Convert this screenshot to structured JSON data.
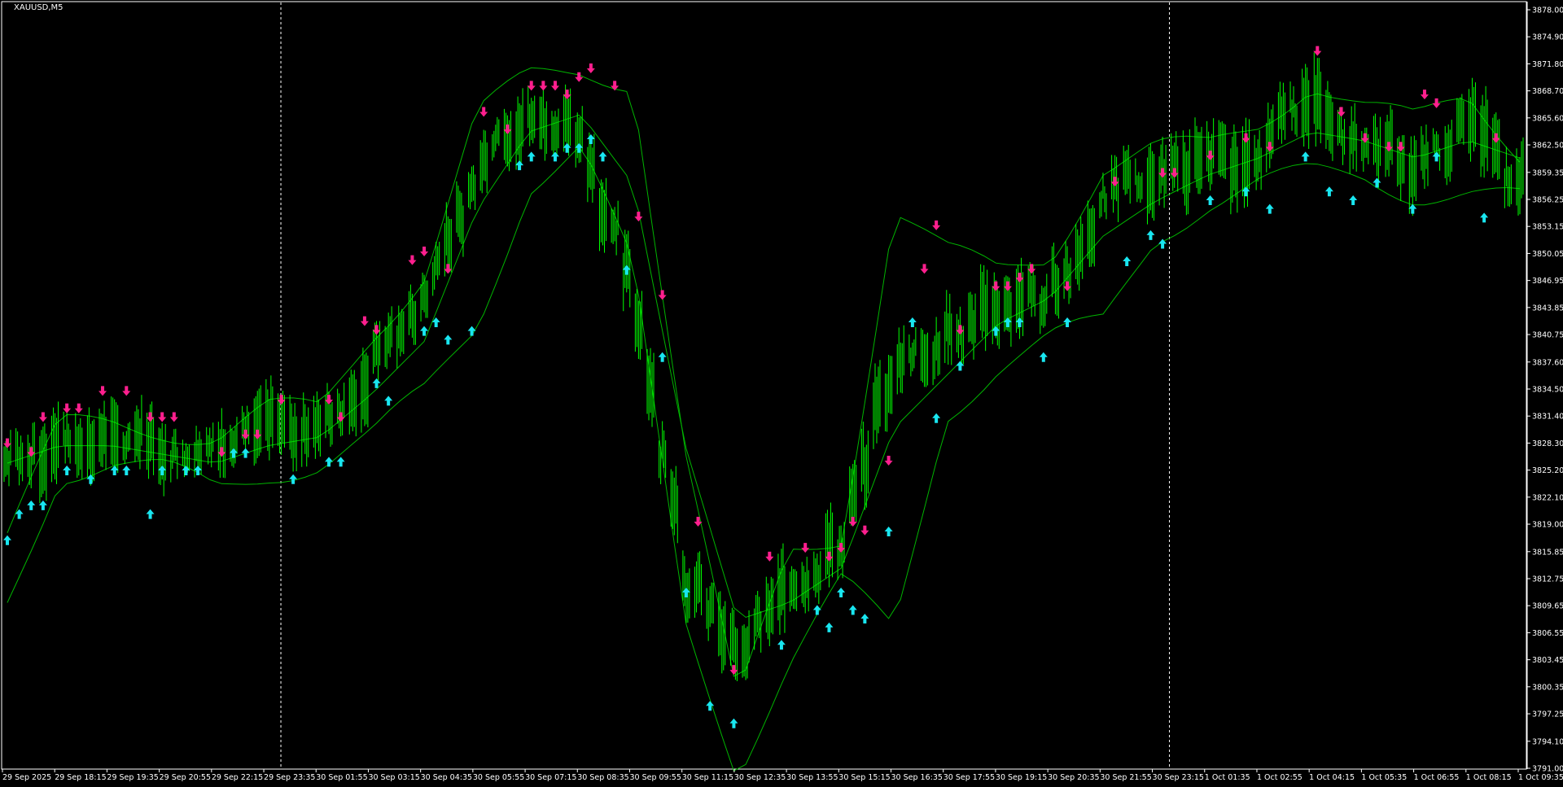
{
  "window": {
    "symbol_title": "XAUUSD,M5"
  },
  "colors": {
    "background": "#000000",
    "frame": "#ffffff",
    "candle": "#00ff00",
    "band": "#00b400",
    "sell_arrow": "#ff1f8e",
    "buy_arrow": "#19e6f0",
    "separator": "#ffffff"
  },
  "price_axis": {
    "labels": [
      "3878.00",
      "3874.90",
      "3871.80",
      "3868.70",
      "3865.60",
      "3862.50",
      "3859.35",
      "3856.25",
      "3853.15",
      "3850.05",
      "3846.95",
      "3843.85",
      "3840.75",
      "3837.60",
      "3834.50",
      "3831.40",
      "3828.30",
      "3825.20",
      "3822.10",
      "3819.00",
      "3815.85",
      "3812.75",
      "3809.65",
      "3806.55",
      "3803.45",
      "3800.35",
      "3797.25",
      "3794.10",
      "3791.00"
    ],
    "top_value": 3878.0,
    "bottom_value": 3791.0
  },
  "time_axis": {
    "labels": [
      "29 Sep 2025",
      "29 Sep 18:15",
      "29 Sep 19:35",
      "29 Sep 20:55",
      "29 Sep 22:15",
      "29 Sep 23:35",
      "30 Sep 01:55",
      "30 Sep 03:15",
      "30 Sep 04:35",
      "30 Sep 05:55",
      "30 Sep 07:15",
      "30 Sep 08:35",
      "30 Sep 09:55",
      "30 Sep 11:15",
      "30 Sep 12:35",
      "30 Sep 13:55",
      "30 Sep 15:15",
      "30 Sep 16:35",
      "30 Sep 17:55",
      "30 Sep 19:15",
      "30 Sep 20:35",
      "30 Sep 21:55",
      "30 Sep 23:15",
      "1 Oct 01:35",
      "1 Oct 02:55",
      "1 Oct 04:15",
      "1 Oct 05:35",
      "1 Oct 06:55",
      "1 Oct 08:15",
      "1 Oct 09:35"
    ]
  },
  "day_separators": [
    "29 Sep 23:35",
    "30 Sep 23:15"
  ],
  "chart_data": {
    "type": "line",
    "title": "XAUUSD,M5",
    "xlabel": "",
    "ylabel": "",
    "ylim": [
      3791.0,
      3878.0
    ],
    "grid": false,
    "x": [
      "29 Sep 2025",
      "29 Sep 18:15",
      "29 Sep 19:35",
      "29 Sep 20:55",
      "29 Sep 22:15",
      "29 Sep 23:35",
      "30 Sep 01:55",
      "30 Sep 03:15",
      "30 Sep 04:35",
      "30 Sep 05:55",
      "30 Sep 07:15",
      "30 Sep 08:35",
      "30 Sep 09:55",
      "30 Sep 11:15",
      "30 Sep 12:35",
      "30 Sep 13:55",
      "30 Sep 15:15",
      "30 Sep 16:35",
      "30 Sep 17:55",
      "30 Sep 19:15",
      "30 Sep 20:35",
      "30 Sep 21:55",
      "30 Sep 23:15",
      "1 Oct 01:35",
      "1 Oct 02:55",
      "1 Oct 04:15",
      "1 Oct 05:35",
      "1 Oct 06:55",
      "1 Oct 08:15",
      "1 Oct 09:35"
    ],
    "series": [
      {
        "values": [
          3826,
          3828.5,
          3829,
          3828,
          3827,
          3830.5,
          3830,
          3837,
          3844,
          3860,
          3867,
          3864,
          3846,
          3814,
          3804,
          3812,
          3816,
          3838,
          3840,
          3845,
          3844,
          3856,
          3859,
          3860,
          3862,
          3868,
          3862,
          3860,
          3866,
          3858
        ]
      },
      {
        "values": [
          3818,
          3830,
          3830.5,
          3830,
          3829,
          3832,
          3832,
          3841,
          3848,
          3866,
          3870,
          3871,
          3870,
          3827,
          3798,
          3816,
          3818,
          3855,
          3850,
          3848,
          3850,
          3860,
          3862,
          3862,
          3865,
          3870,
          3867,
          3865,
          3868,
          3862
        ]
      },
      {
        "values": [
          3826,
          3828,
          3828,
          3827,
          3826,
          3828,
          3829,
          3834,
          3840,
          3855,
          3864,
          3866,
          3858,
          3828,
          3808,
          3810,
          3814,
          3830,
          3836,
          3842,
          3845,
          3852,
          3856,
          3859,
          3861,
          3864,
          3863,
          3861,
          3863,
          3861
        ]
      },
      {
        "values": [
          3810,
          3825,
          3826,
          3825,
          3823,
          3825,
          3826,
          3829,
          3834,
          3842,
          3858,
          3862,
          3848,
          3808,
          3791,
          3803,
          3812,
          3807,
          3832,
          3837,
          3840,
          3842,
          3852,
          3856,
          3858,
          3859,
          3859,
          3857,
          3857,
          3856
        ]
      }
    ]
  },
  "signals": {
    "sell_arrows": [
      [
        0,
        3828
      ],
      [
        2,
        3827
      ],
      [
        3,
        3831
      ],
      [
        5,
        3832
      ],
      [
        6,
        3832
      ],
      [
        8,
        3834
      ],
      [
        10,
        3834
      ],
      [
        12,
        3831
      ],
      [
        13,
        3831
      ],
      [
        14,
        3831
      ],
      [
        18,
        3827
      ],
      [
        20,
        3829
      ],
      [
        21,
        3829
      ],
      [
        23,
        3833
      ],
      [
        27,
        3833
      ],
      [
        28,
        3831
      ],
      [
        30,
        3842
      ],
      [
        31,
        3841
      ],
      [
        34,
        3849
      ],
      [
        35,
        3850
      ],
      [
        37,
        3848
      ],
      [
        40,
        3866
      ],
      [
        42,
        3864
      ],
      [
        44,
        3869
      ],
      [
        45,
        3869
      ],
      [
        46,
        3869
      ],
      [
        47,
        3868
      ],
      [
        48,
        3870
      ],
      [
        49,
        3871
      ],
      [
        51,
        3869
      ],
      [
        53,
        3854
      ],
      [
        55,
        3845
      ],
      [
        58,
        3819
      ],
      [
        61,
        3802
      ],
      [
        64,
        3815
      ],
      [
        67,
        3816
      ],
      [
        69,
        3815
      ],
      [
        70,
        3816
      ],
      [
        71,
        3819
      ],
      [
        72,
        3818
      ],
      [
        74,
        3826
      ],
      [
        77,
        3848
      ],
      [
        78,
        3853
      ],
      [
        80,
        3841
      ],
      [
        83,
        3846
      ],
      [
        84,
        3846
      ],
      [
        85,
        3847
      ],
      [
        86,
        3848
      ],
      [
        89,
        3846
      ],
      [
        93,
        3858
      ],
      [
        97,
        3859
      ],
      [
        98,
        3859
      ],
      [
        101,
        3861
      ],
      [
        104,
        3863
      ],
      [
        106,
        3862
      ],
      [
        110,
        3873
      ],
      [
        112,
        3866
      ],
      [
        114,
        3863
      ],
      [
        116,
        3862
      ],
      [
        117,
        3862
      ],
      [
        119,
        3868
      ],
      [
        120,
        3867
      ],
      [
        125,
        3863
      ]
    ],
    "buy_arrows": [
      [
        0,
        3818
      ],
      [
        1,
        3821
      ],
      [
        2,
        3822
      ],
      [
        3,
        3822
      ],
      [
        5,
        3826
      ],
      [
        7,
        3825
      ],
      [
        9,
        3826
      ],
      [
        10,
        3826
      ],
      [
        12,
        3821
      ],
      [
        13,
        3826
      ],
      [
        15,
        3826
      ],
      [
        16,
        3826
      ],
      [
        19,
        3828
      ],
      [
        20,
        3828
      ],
      [
        24,
        3825
      ],
      [
        27,
        3827
      ],
      [
        28,
        3827
      ],
      [
        31,
        3836
      ],
      [
        32,
        3834
      ],
      [
        35,
        3842
      ],
      [
        36,
        3843
      ],
      [
        37,
        3841
      ],
      [
        39,
        3842
      ],
      [
        43,
        3861
      ],
      [
        44,
        3862
      ],
      [
        46,
        3862
      ],
      [
        47,
        3863
      ],
      [
        48,
        3863
      ],
      [
        49,
        3864
      ],
      [
        50,
        3862
      ],
      [
        52,
        3849
      ],
      [
        55,
        3839
      ],
      [
        57,
        3812
      ],
      [
        59,
        3799
      ],
      [
        61,
        3797
      ],
      [
        65,
        3806
      ],
      [
        68,
        3810
      ],
      [
        69,
        3808
      ],
      [
        70,
        3812
      ],
      [
        71,
        3810
      ],
      [
        72,
        3809
      ],
      [
        74,
        3819
      ],
      [
        76,
        3843
      ],
      [
        78,
        3832
      ],
      [
        80,
        3838
      ],
      [
        83,
        3842
      ],
      [
        84,
        3843
      ],
      [
        85,
        3843
      ],
      [
        87,
        3839
      ],
      [
        89,
        3843
      ],
      [
        94,
        3850
      ],
      [
        96,
        3853
      ],
      [
        97,
        3852
      ],
      [
        101,
        3857
      ],
      [
        104,
        3858
      ],
      [
        106,
        3856
      ],
      [
        109,
        3862
      ],
      [
        111,
        3858
      ],
      [
        113,
        3857
      ],
      [
        115,
        3859
      ],
      [
        118,
        3856
      ],
      [
        120,
        3862
      ],
      [
        124,
        3855
      ]
    ]
  }
}
